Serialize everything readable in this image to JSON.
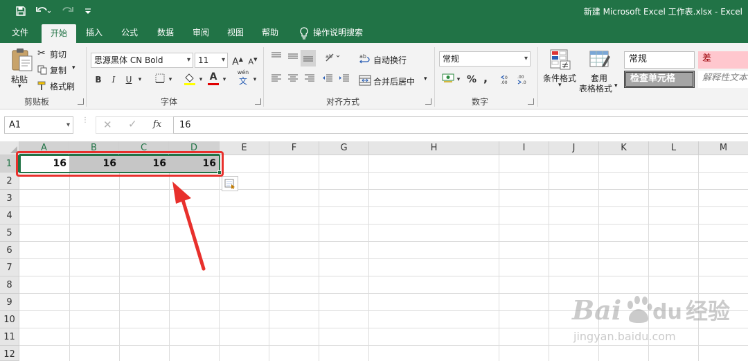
{
  "title_bar": {
    "title": "新建 Microsoft Excel 工作表.xlsx  -  Excel",
    "icons": [
      "save-icon",
      "undo-icon",
      "redo-icon",
      "customize-qat-icon"
    ]
  },
  "tabs": [
    {
      "label": "文件"
    },
    {
      "label": "开始"
    },
    {
      "label": "插入"
    },
    {
      "label": "公式"
    },
    {
      "label": "数据"
    },
    {
      "label": "审阅"
    },
    {
      "label": "视图"
    },
    {
      "label": "帮助"
    }
  ],
  "active_tab": "开始",
  "tell_me": {
    "label": "操作说明搜索",
    "icon": "lightbulb-icon"
  },
  "ribbon": {
    "clipboard": {
      "group_label": "剪贴板",
      "paste": "粘贴",
      "cut": "剪切",
      "copy": "复制",
      "format_painter": "格式刷"
    },
    "font": {
      "group_label": "字体",
      "font_name": "思源黑体 CN Bold",
      "font_size": "11",
      "bold": "B",
      "italic": "I",
      "underline": "U",
      "grow": "A",
      "shrink": "A",
      "font_color_glyph": "A",
      "phonetic": "wén",
      "phonetic_char": "文"
    },
    "alignment": {
      "group_label": "对齐方式",
      "wrap_text": "自动换行",
      "merge_center": "合并后居中"
    },
    "number": {
      "group_label": "数字",
      "format": "常规",
      "percent": "%",
      "comma": ","
    },
    "styles": {
      "conditional_formatting": "条件格式",
      "format_as_table_1": "套用",
      "format_as_table_2": "表格格式",
      "style_normal": "常规",
      "style_bad": "差",
      "style_check_cell": "检查单元格",
      "style_explanatory": "解释性文本"
    }
  },
  "formula_bar": {
    "name_box": "A1",
    "fx": "fx",
    "content": "16"
  },
  "grid": {
    "columns": [
      "A",
      "B",
      "C",
      "D",
      "E",
      "F",
      "G",
      "H",
      "I",
      "J",
      "K",
      "L",
      "M"
    ],
    "selected_columns": [
      "A",
      "B",
      "C",
      "D"
    ],
    "rows": [
      "1",
      "2",
      "3",
      "4",
      "5",
      "6",
      "7",
      "8",
      "9",
      "10",
      "11",
      "12"
    ],
    "selected_row": "1",
    "cells": {
      "A1": "16",
      "B1": "16",
      "C1": "16",
      "D1": "16"
    }
  },
  "colors": {
    "excel_green": "#217346",
    "annotation_red": "#e8302c",
    "selection_fill": "#c6c6c6"
  },
  "watermark": {
    "brand": "Bai",
    "brand_du": "du",
    "product": "经验",
    "url": "jingyan.baidu.com"
  }
}
